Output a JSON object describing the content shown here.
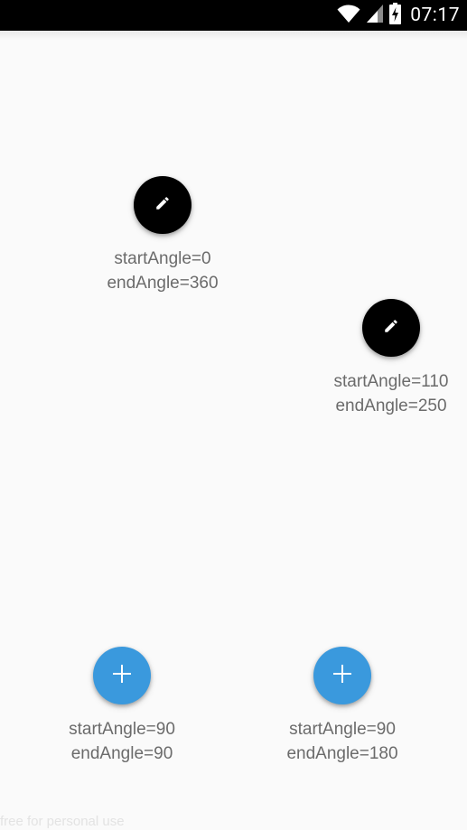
{
  "status_bar": {
    "time": "07:17",
    "icons": [
      "wifi-icon",
      "signal-icon",
      "battery-charging-icon"
    ]
  },
  "fabs": [
    {
      "icon": "pencil-icon",
      "color": "#000000",
      "start_label": "startAngle=0",
      "end_label": "endAngle=360"
    },
    {
      "icon": "pencil-icon",
      "color": "#000000",
      "start_label": "startAngle=110",
      "end_label": "endAngle=250"
    },
    {
      "icon": "plus-icon",
      "color": "#3a99dd",
      "start_label": "startAngle=90",
      "end_label": "endAngle=90"
    },
    {
      "icon": "plus-icon",
      "color": "#3a99dd",
      "start_label": "startAngle=90",
      "end_label": "endAngle=180"
    }
  ],
  "watermark": "free for personal use"
}
